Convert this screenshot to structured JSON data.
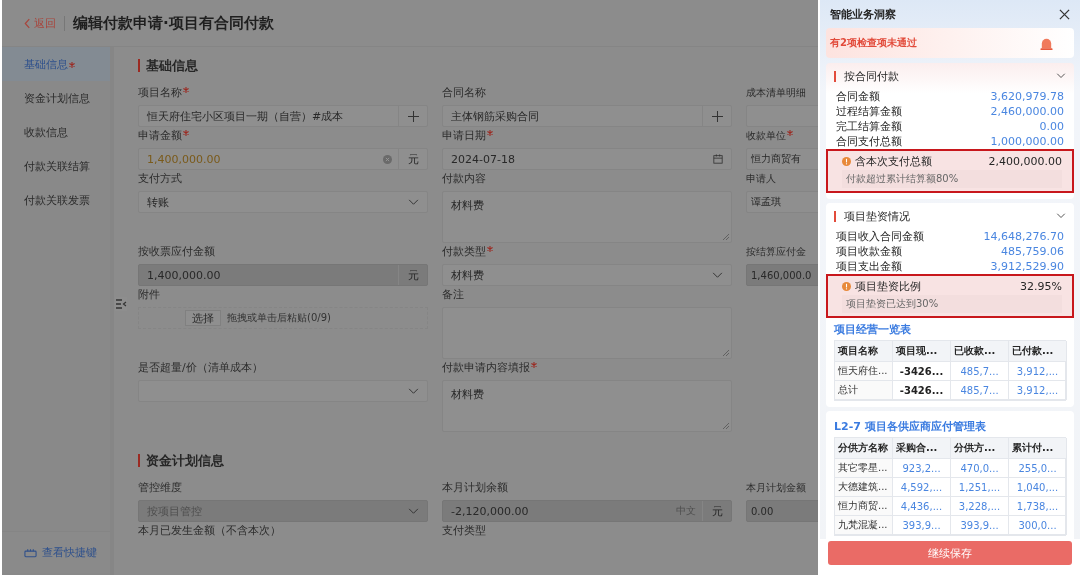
{
  "header": {
    "back": "返回",
    "title": "编辑付款申请·项目有合同付款"
  },
  "nav": [
    {
      "label": "基础信息",
      "required": true,
      "selected": true
    },
    {
      "label": "资金计划信息",
      "required": false,
      "selected": false
    },
    {
      "label": "收款信息",
      "required": false,
      "selected": false
    },
    {
      "label": "付款关联结算",
      "required": false,
      "selected": false
    },
    {
      "label": "付款关联发票",
      "required": false,
      "selected": false
    }
  ],
  "nav_footer": "查看快捷键",
  "sections": [
    {
      "title": "基础信息",
      "rows": [
        [
          {
            "label": "项目名称",
            "required": true,
            "kind": "picker",
            "value": "恒天府住宅小区项目一期（自营）#成本",
            "disabled": false
          },
          {
            "label": "合同名称",
            "required": false,
            "kind": "picker",
            "value": "主体钢筋采购合同",
            "disabled": false
          },
          {
            "label": "成本清单明细",
            "required": false,
            "kind": "text",
            "disabled": false
          }
        ],
        [
          {
            "label": "申请金额",
            "required": true,
            "kind": "amount",
            "value": "1,400,000.00",
            "unit": "元",
            "warning": true,
            "clearable": true,
            "disabled": false
          },
          {
            "label": "申请日期",
            "required": true,
            "kind": "date",
            "value": "2024-07-18",
            "disabled": false
          },
          {
            "label": "收款单位",
            "required": true,
            "kind": "text",
            "value": "恒力商贸有",
            "disabled": false
          }
        ],
        [
          {
            "label": "支付方式",
            "required": false,
            "kind": "select",
            "value": "转账",
            "disabled": false
          },
          {
            "label": "付款内容",
            "required": false,
            "kind": "textarea",
            "value": "材料费",
            "disabled": false
          },
          {
            "label": "申请人",
            "required": false,
            "kind": "text",
            "value": "谭孟琪",
            "disabled": false
          }
        ],
        [
          {
            "label": "按收票应付金额",
            "required": false,
            "kind": "amount",
            "value": "1,400,000.00",
            "unit": "元",
            "warning": false,
            "clearable": false,
            "disabled": true
          },
          {
            "label": "付款类型",
            "required": true,
            "kind": "select",
            "value": "材料费",
            "disabled": false
          },
          {
            "label": "按结算应付金",
            "required": false,
            "kind": "text",
            "value": "1,460,000.0",
            "disabled": true
          }
        ],
        [
          {
            "label": "附件",
            "required": false,
            "kind": "upload",
            "button": "选择",
            "hint": "拖拽或单击后粘贴(0/9)",
            "disabled": false
          },
          {
            "label": "备注",
            "required": false,
            "kind": "textarea",
            "disabled": false
          }
        ],
        [
          {
            "label": "是否超量/价（清单成本）",
            "required": false,
            "kind": "select",
            "disabled": false
          },
          {
            "label": "付款申请内容填报",
            "required": true,
            "kind": "textarea",
            "value": "材料费",
            "disabled": false
          }
        ]
      ]
    },
    {
      "title": "资金计划信息",
      "rows": [
        [
          {
            "label": "管控维度",
            "required": false,
            "kind": "select",
            "placeholder": "按项目管控",
            "disabled": true
          },
          {
            "label": "本月计划余额",
            "required": false,
            "kind": "amount",
            "value": "-2,120,000.00",
            "hint": "中文",
            "unit": "元",
            "warning": false,
            "clearable": false,
            "disabled": true
          },
          {
            "label": "本月计划金额",
            "required": false,
            "kind": "text",
            "value": "0.00",
            "disabled": true
          }
        ],
        [
          {
            "label": "本月已发生金额（不含本次）",
            "required": false,
            "kind": "label"
          },
          {
            "label": "支付类型",
            "required": false,
            "kind": "label"
          }
        ]
      ]
    }
  ],
  "drawer": {
    "title": "智能业务洞察",
    "alert": "有2项检查项未通过",
    "cards": [
      {
        "title": "按合同付款",
        "expanded": true,
        "rows": [
          {
            "label": "合同金额",
            "value": "3,620,979.78"
          },
          {
            "label": "过程结算金额",
            "value": "2,460,000.00"
          },
          {
            "label": "完工结算金额",
            "value": "0.00"
          },
          {
            "label": "合同支付总额",
            "value": "1,000,000.00"
          }
        ],
        "check": {
          "label": "含本次支付总额",
          "value": "2,400,000.00",
          "note": "付款超过累计结算额80%"
        }
      },
      {
        "title": "项目垫资情况",
        "expanded": true,
        "rows": [
          {
            "label": "项目收入合同金额",
            "value": "14,648,276.70"
          },
          {
            "label": "项目收款金额",
            "value": "485,759.06"
          },
          {
            "label": "项目支出金额",
            "value": "3,912,529.90"
          }
        ],
        "check": {
          "label": "项目垫资比例",
          "value": "32.95%",
          "note": "项目垫资已达到30%"
        },
        "table": {
          "title": "项目经营一览表",
          "columns": [
            {
              "label": "项目名称",
              "kind": "name"
            },
            {
              "label": "项目现...",
              "kind": "number"
            },
            {
              "label": "已收款...",
              "kind": "link"
            },
            {
              "label": "已付款...",
              "kind": "link"
            }
          ],
          "rows": [
            [
              "恒天府住...",
              "-3426...",
              "485,7...",
              "3,912,..."
            ],
            [
              "总计",
              "-3426...",
              "485,7...",
              "3,912,..."
            ]
          ]
        }
      },
      {
        "table": {
          "title": "L2-7 项目各供应商应付管理表",
          "columns": [
            {
              "label": "分供方名称",
              "kind": "name"
            },
            {
              "label": "采购合...",
              "kind": "link"
            },
            {
              "label": "分供方...",
              "kind": "link"
            },
            {
              "label": "累计付...",
              "kind": "link"
            }
          ],
          "rows": [
            [
              "其它零星...",
              "923,2...",
              "470,0...",
              "255,0..."
            ],
            [
              "大德建筑...",
              "4,592,...",
              "1,251,...",
              "1,040,..."
            ],
            [
              "恒力商贸...",
              "4,436,...",
              "3,228,...",
              "1,738,..."
            ],
            [
              "九梵混凝...",
              "393,9...",
              "393,9...",
              "300,0..."
            ]
          ]
        }
      }
    ],
    "button": "继续保存"
  }
}
